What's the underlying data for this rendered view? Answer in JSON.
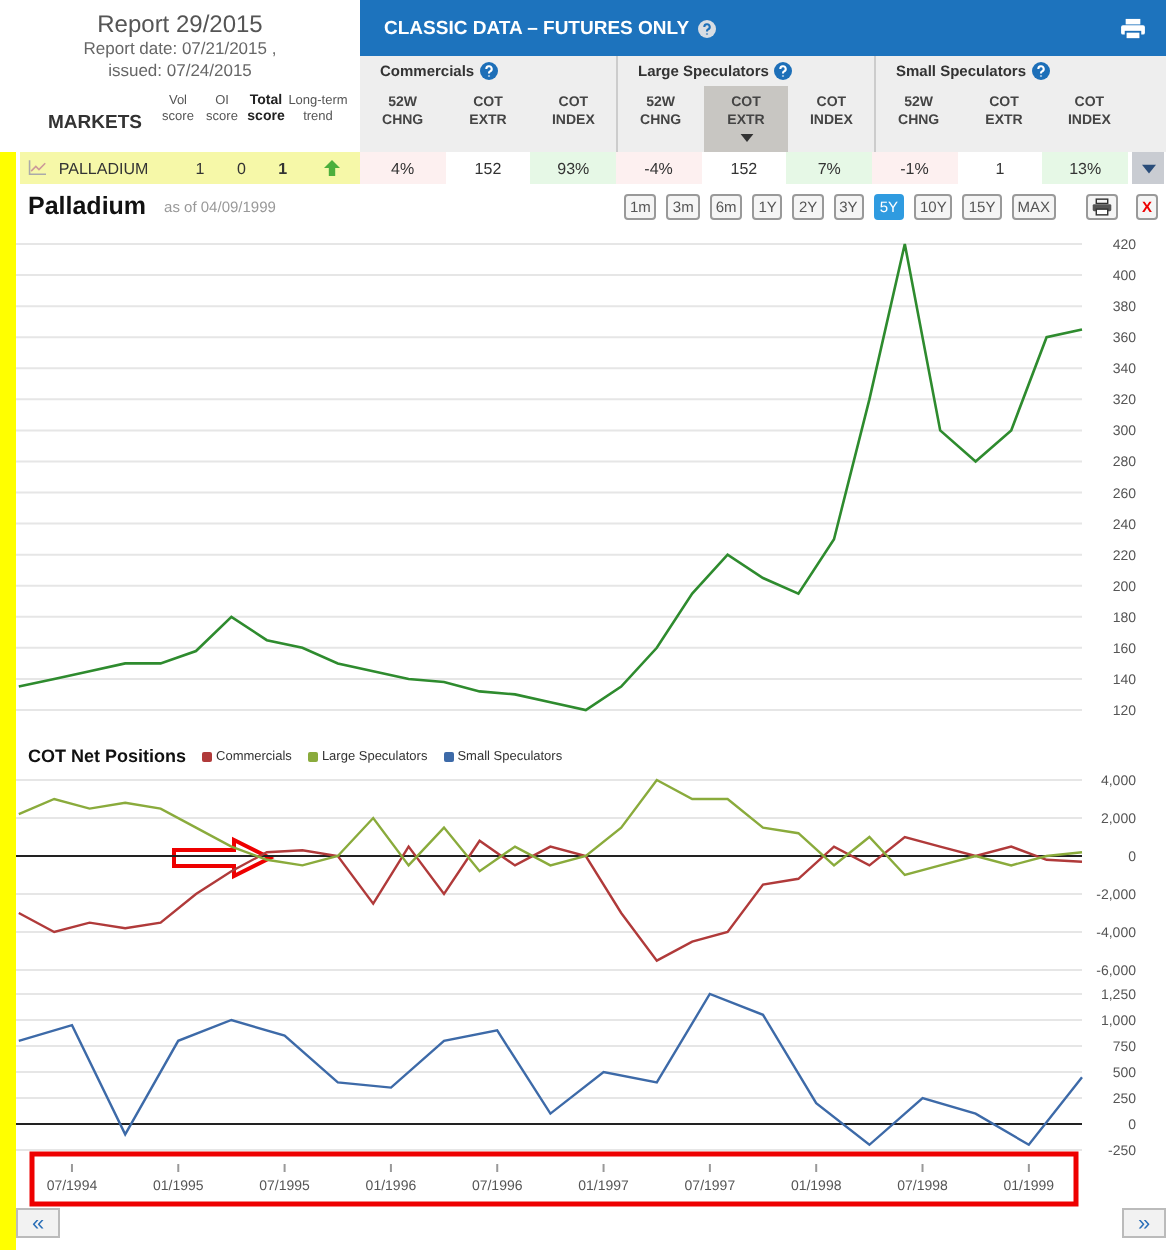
{
  "report": {
    "title": "Report 29/2015",
    "date": "Report date: 07/21/2015 ,",
    "issued": "issued: 07/24/2015"
  },
  "markets": {
    "label": "MARKETS",
    "score_headers": [
      {
        "label": "Vol score",
        "emphasis": false
      },
      {
        "label": "OI score",
        "emphasis": false
      },
      {
        "label": "Total score",
        "emphasis": true
      },
      {
        "label": "Long-term trend",
        "emphasis": false
      }
    ]
  },
  "classic": {
    "title": "CLASSIC DATA – FUTURES ONLY",
    "groups": [
      {
        "name": "Commercials",
        "columns": [
          {
            "label": "52W CHNG",
            "kind": "change",
            "selected": false
          },
          {
            "label": "COT EXTR",
            "kind": "extreme",
            "selected": false
          },
          {
            "label": "COT INDEX",
            "kind": "index",
            "selected": false
          }
        ]
      },
      {
        "name": "Large Speculators",
        "columns": [
          {
            "label": "52W CHNG",
            "kind": "change",
            "selected": false
          },
          {
            "label": "COT EXTR",
            "kind": "extreme",
            "selected": true
          },
          {
            "label": "COT INDEX",
            "kind": "index",
            "selected": false
          }
        ]
      },
      {
        "name": "Small Speculators",
        "columns": [
          {
            "label": "52W CHNG",
            "kind": "change",
            "selected": false
          },
          {
            "label": "COT EXTR",
            "kind": "extreme",
            "selected": false
          },
          {
            "label": "COT INDEX",
            "kind": "index",
            "selected": false
          }
        ]
      }
    ]
  },
  "row": {
    "market": "PALLADIUM",
    "scores": [
      "1",
      "0",
      "1"
    ],
    "trend_up": true,
    "cells": [
      "4%",
      "152",
      "93%",
      "-4%",
      "152",
      "7%",
      "-1%",
      "1",
      "13%"
    ]
  },
  "price": {
    "title": "Palladium",
    "as_of": "as of 04/09/1999",
    "ranges": [
      {
        "label": "1m",
        "selected": false
      },
      {
        "label": "3m",
        "selected": false
      },
      {
        "label": "6m",
        "selected": false
      },
      {
        "label": "1Y",
        "selected": false
      },
      {
        "label": "2Y",
        "selected": false
      },
      {
        "label": "3Y",
        "selected": false
      },
      {
        "label": "5Y",
        "selected": true
      },
      {
        "label": "10Y",
        "selected": false
      },
      {
        "label": "15Y",
        "selected": false
      },
      {
        "label": "MAX",
        "selected": false
      }
    ],
    "close": "X",
    "chart_data": {
      "type": "line",
      "grid": true,
      "categories": [
        null,
        null,
        null,
        null,
        null,
        null,
        null,
        null,
        null,
        null,
        null,
        null,
        null,
        null,
        null,
        null,
        null,
        null,
        null,
        null,
        null,
        null,
        null,
        null,
        null,
        null,
        null,
        null,
        null,
        null,
        null
      ],
      "ylim": [
        120,
        420
      ],
      "yticks": [
        {
          "value": 420,
          "label": "420"
        },
        {
          "value": 400,
          "label": "400"
        },
        {
          "value": 380,
          "label": "380"
        },
        {
          "value": 360,
          "label": "360"
        },
        {
          "value": 340,
          "label": "340"
        },
        {
          "value": 320,
          "label": "320"
        },
        {
          "value": 300,
          "label": "300"
        },
        {
          "value": 280,
          "label": "280"
        },
        {
          "value": 260,
          "label": "260"
        },
        {
          "value": 240,
          "label": "240"
        },
        {
          "value": 220,
          "label": "220"
        },
        {
          "value": 200,
          "label": "200"
        },
        {
          "value": 180,
          "label": "180"
        },
        {
          "value": 160,
          "label": "160"
        },
        {
          "value": 140,
          "label": "140"
        },
        {
          "value": 120,
          "label": "120"
        }
      ],
      "series": [
        {
          "color": "#2e8b2e",
          "values": [
            135,
            140,
            145,
            150,
            150,
            158,
            180,
            165,
            160,
            150,
            145,
            140,
            138,
            132,
            130,
            125,
            120,
            135,
            160,
            195,
            220,
            205,
            195,
            230,
            320,
            420,
            300,
            280,
            300,
            360,
            365
          ]
        }
      ]
    }
  },
  "cot": {
    "title": "COT Net Positions",
    "net_chart": {
      "chart_data": {
        "type": "line",
        "grid": true,
        "categories": [
          null,
          null,
          null,
          null,
          null,
          null,
          null,
          null,
          null,
          null,
          null,
          null,
          null,
          null,
          null,
          null,
          null,
          null,
          null,
          null,
          null,
          null,
          null,
          null,
          null,
          null,
          null,
          null,
          null,
          null,
          null
        ],
        "ylim": [
          -6000,
          4000
        ],
        "yticks": [
          {
            "value": 4000,
            "label": "4,000"
          },
          {
            "value": 2000,
            "label": "2,000"
          },
          {
            "value": 0,
            "label": "0"
          },
          {
            "value": -2000,
            "label": "-2,000"
          },
          {
            "value": -4000,
            "label": "-4,000"
          },
          {
            "value": -6000,
            "label": "-6,000"
          }
        ],
        "series": [
          {
            "name": "Commercials",
            "color": "#b03a3a",
            "values": [
              -3000,
              -4000,
              -3500,
              -3800,
              -3500,
              -2000,
              -800,
              200,
              300,
              0,
              -2500,
              500,
              -2000,
              800,
              -500,
              500,
              0,
              -3000,
              -5500,
              -4500,
              -4000,
              -1500,
              -1200,
              500,
              -500,
              1000,
              500,
              0,
              500,
              -200,
              -300
            ]
          },
          {
            "name": "Large Speculators",
            "color": "#8aab3c",
            "values": [
              2200,
              3000,
              2500,
              2800,
              2500,
              1500,
              500,
              -200,
              -500,
              0,
              2000,
              -500,
              1500,
              -800,
              500,
              -500,
              0,
              1500,
              4000,
              3000,
              3000,
              1500,
              1200,
              -500,
              1000,
              -1000,
              -500,
              0,
              -500,
              0,
              200
            ]
          }
        ]
      }
    },
    "small_chart": {
      "chart_data": {
        "type": "line",
        "grid": true,
        "categories": [
          null,
          "07/1994",
          null,
          "01/1995",
          null,
          "07/1995",
          null,
          "01/1996",
          null,
          "07/1996",
          null,
          "01/1997",
          null,
          "07/1997",
          null,
          "01/1998",
          null,
          "07/1998",
          null,
          "01/1999",
          null
        ],
        "ylim": [
          -250,
          1250
        ],
        "yticks": [
          {
            "value": 1250,
            "label": "1,250"
          },
          {
            "value": 1000,
            "label": "1,000"
          },
          {
            "value": 750,
            "label": "750"
          },
          {
            "value": 500,
            "label": "500"
          },
          {
            "value": 250,
            "label": "250"
          },
          {
            "value": 0,
            "label": "0"
          },
          {
            "value": -250,
            "label": "-250"
          }
        ],
        "series": [
          {
            "name": "Small Speculators",
            "color": "#3d6aa8",
            "values": [
              800,
              950,
              -100,
              800,
              1000,
              850,
              400,
              350,
              800,
              900,
              100,
              500,
              400,
              1250,
              1050,
              200,
              -200,
              250,
              100,
              -200,
              450
            ]
          }
        ]
      }
    }
  },
  "nav": {
    "back": "«",
    "forward": "»"
  }
}
